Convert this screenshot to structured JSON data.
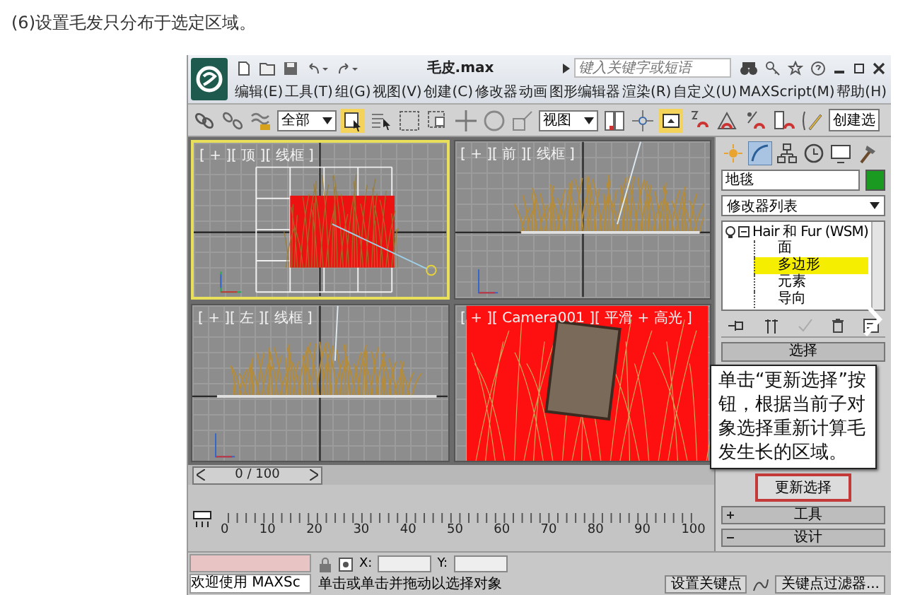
{
  "caption": "(6)设置毛发只分布于选定区域。",
  "app": {
    "title": "毛皮.max",
    "search": {
      "placeholder": "键入关键字或短语"
    },
    "menu": [
      "编辑(E)",
      "工具(T)",
      "组(G)",
      "视图(V)",
      "创建(C)",
      "修改器",
      "动画",
      "图形编辑器",
      "渲染(R)",
      "自定义(U)",
      "MAXScript(M)",
      "帮助(H)"
    ],
    "toolbar": {
      "tools": [
        {
          "kind": "link",
          "on": false
        },
        {
          "kind": "unlink",
          "on": false
        },
        {
          "kind": "bind",
          "on": false
        },
        {
          "kind": "filter",
          "label": "全部"
        },
        {
          "kind": "select",
          "on": true
        },
        {
          "kind": "select_by_name",
          "on": false
        },
        {
          "kind": "region",
          "on": false
        },
        {
          "kind": "window",
          "on": false
        },
        {
          "kind": "move",
          "on": false
        },
        {
          "kind": "rotate",
          "on": false
        },
        {
          "kind": "scale",
          "on": false
        },
        {
          "kind": "coord",
          "label": "视图"
        },
        {
          "kind": "pivot",
          "on": false
        },
        {
          "kind": "manipulate",
          "on": false
        },
        {
          "kind": "keyboard",
          "on": true
        },
        {
          "kind": "snap",
          "on": false
        },
        {
          "kind": "angle_snap",
          "on": false
        },
        {
          "kind": "percent_snap",
          "on": false
        },
        {
          "kind": "spinner_snap",
          "on": false
        },
        {
          "kind": "edit_named",
          "on": false
        },
        {
          "kind": "named_set",
          "label": "创建选"
        }
      ]
    },
    "viewports": [
      {
        "kind": "top",
        "label": "[ + ][ 顶 ][ 线框 ]",
        "active": true
      },
      {
        "kind": "front",
        "label": "[ + ][ 前 ][ 线框 ]",
        "active": false
      },
      {
        "kind": "left",
        "label": "[ + ][ 左 ][ 线框 ]",
        "active": false
      },
      {
        "kind": "camera",
        "label": "[ + ][ Camera001 ][ 平滑 + 高光 ]",
        "active": false
      }
    ],
    "time_slider": {
      "label": "0 / 100",
      "level": 0
    },
    "ruler": [
      "0",
      "10",
      "20",
      "30",
      "40",
      "50",
      "60",
      "70",
      "80",
      "90",
      "100"
    ],
    "command_panel": {
      "tabs": [
        {
          "kind": "create",
          "selected": false
        },
        {
          "kind": "modify",
          "selected": true
        },
        {
          "kind": "hierarchy",
          "selected": false
        },
        {
          "kind": "motion",
          "selected": false
        },
        {
          "kind": "display",
          "selected": false
        },
        {
          "kind": "utilities",
          "selected": false
        }
      ],
      "object_name": "地毯",
      "modifier_list": "修改器列表",
      "stack": [
        {
          "label": "Hair 和 Fur (WSM)",
          "expanded": true,
          "children": [
            {
              "label": "面",
              "selected": false
            },
            {
              "label": "多边形",
              "selected": true
            },
            {
              "label": "元素",
              "selected": false
            },
            {
              "label": "导向",
              "selected": false
            }
          ]
        }
      ],
      "selection_rollout": "选择",
      "update_button": "更新选择",
      "rollouts": [
        {
          "label": "工具",
          "expanded": false
        },
        {
          "label": "设计",
          "expanded": true
        }
      ]
    },
    "callout": "单击“更新选择”按钮，根据当前子对象选择重新计算毛发生长的区域。",
    "status": {
      "prompt": "欢迎使用 MAXSc",
      "x_label": "X:",
      "y_label": "Y:",
      "message": "单击或单击并拖动以选择对象",
      "set_key": "设置关键点",
      "key_filters": "关键点过滤器..."
    }
  }
}
